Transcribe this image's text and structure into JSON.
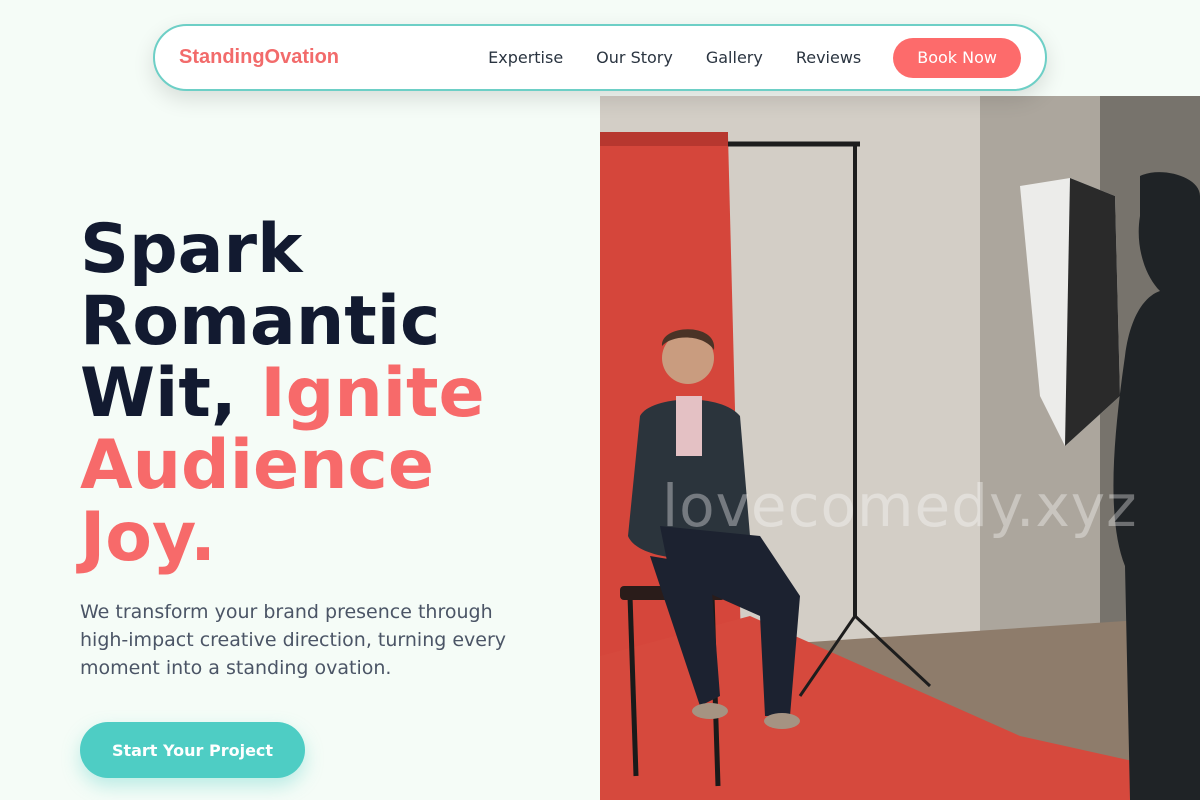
{
  "brand": {
    "name": "StandingOvation",
    "color": "#f26b6b"
  },
  "nav": {
    "links": [
      "Expertise",
      "Our Story",
      "Gallery",
      "Reviews"
    ],
    "cta_label": "Book Now"
  },
  "hero": {
    "title_dark": "Spark Romantic Wit,",
    "title_accent": "Ignite Audience Joy.",
    "subtitle": "We transform your brand presence through high-impact creative direction, turning every moment into a standing ovation.",
    "cta_label": "Start Your Project",
    "image": {
      "description_icon": "photo-studio-image",
      "watermark": "lovecomedy.xyz"
    }
  },
  "colors": {
    "accent_coral": "#f76a6a",
    "accent_teal": "#4ecdc4",
    "title_dark": "#121a30",
    "background": "#f5fcf7"
  }
}
